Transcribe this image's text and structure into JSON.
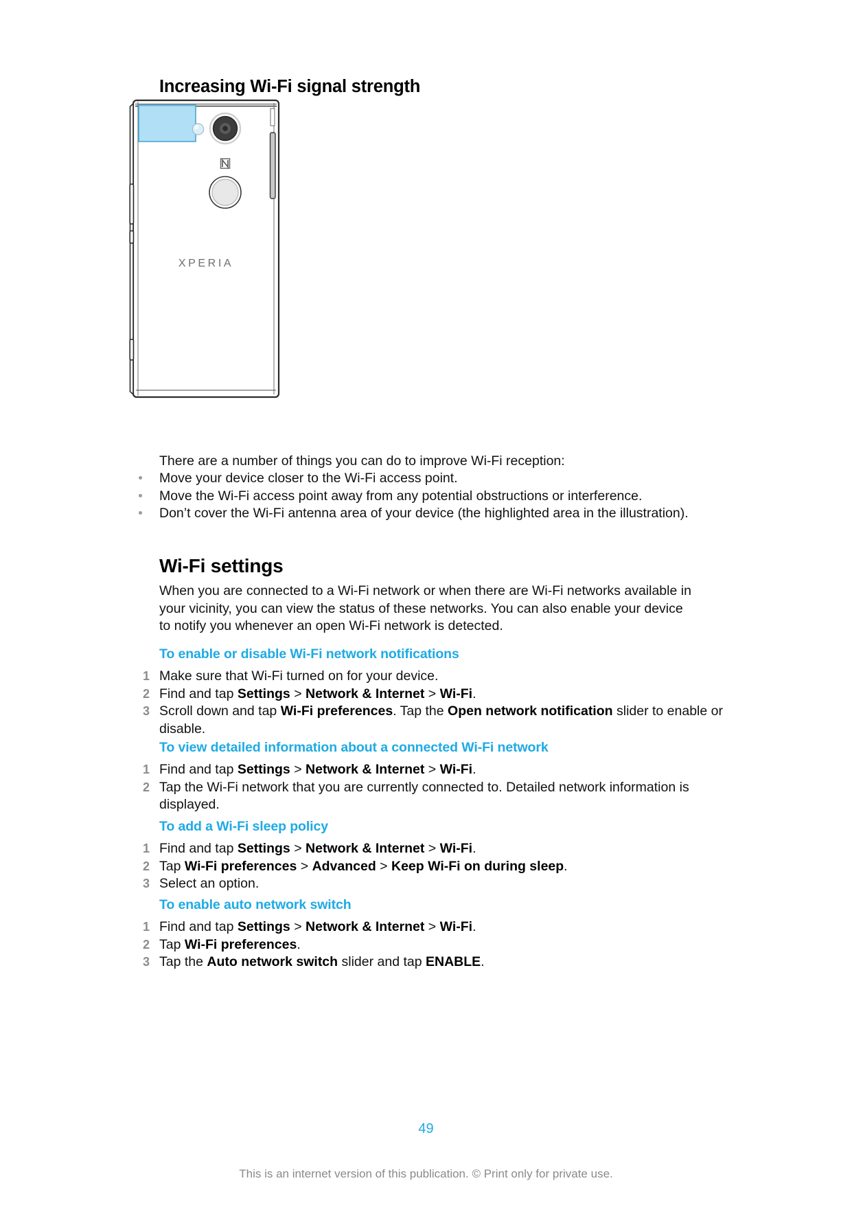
{
  "document": {
    "section_heading": "Increasing Wi-Fi signal strength",
    "illustration": {
      "device_brand": "XPERIA",
      "nfc_label": "N",
      "highlight_color": "#a9dcf5",
      "highlight_border_color": "#4ba7cf",
      "alt": "Back view of Xperia phone with highlighted Wi-Fi antenna area in top left corner"
    },
    "intro": "There are a number of things you can do to improve Wi-Fi reception:",
    "bullets": [
      "Move your device closer to the Wi-Fi access point.",
      "Move the Wi-Fi access point away from any potential obstructions or interference.",
      "Don’t cover the Wi-Fi antenna area of your device (the highlighted area in the illustration)."
    ],
    "major_heading": "Wi-Fi settings",
    "paragraph": "When you are connected to a Wi-Fi network or when there are Wi-Fi networks available in your vicinity, you can view the status of these networks. You can also enable your device to notify you whenever an open Wi-Fi network is detected.",
    "procedures": [
      {
        "heading": "To enable or disable Wi-Fi network notifications",
        "steps": [
          [
            {
              "t": "Make sure that Wi-Fi turned on for your device.",
              "bold": false
            }
          ],
          [
            {
              "t": "Find and tap ",
              "bold": false
            },
            {
              "t": "Settings",
              "bold": true
            },
            {
              "t": " > ",
              "bold": false
            },
            {
              "t": "Network & Internet",
              "bold": true
            },
            {
              "t": " > ",
              "bold": false
            },
            {
              "t": "Wi-Fi",
              "bold": true
            },
            {
              "t": ".",
              "bold": false
            }
          ],
          [
            {
              "t": "Scroll down and tap ",
              "bold": false
            },
            {
              "t": "Wi-Fi preferences",
              "bold": true
            },
            {
              "t": ". Tap the ",
              "bold": false
            },
            {
              "t": "Open network notification",
              "bold": true
            },
            {
              "t": " slider to enable or disable.",
              "bold": false
            }
          ]
        ]
      },
      {
        "heading": "To view detailed information about a connected Wi-Fi network",
        "steps": [
          [
            {
              "t": "Find and tap ",
              "bold": false
            },
            {
              "t": "Settings",
              "bold": true
            },
            {
              "t": " > ",
              "bold": false
            },
            {
              "t": "Network & Internet",
              "bold": true
            },
            {
              "t": " > ",
              "bold": false
            },
            {
              "t": "Wi-Fi",
              "bold": true
            },
            {
              "t": ".",
              "bold": false
            }
          ],
          [
            {
              "t": "Tap the Wi-Fi network that you are currently connected to. Detailed network information is displayed.",
              "bold": false
            }
          ]
        ]
      },
      {
        "heading": "To add a Wi-Fi sleep policy",
        "steps": [
          [
            {
              "t": "Find and tap ",
              "bold": false
            },
            {
              "t": "Settings",
              "bold": true
            },
            {
              "t": " > ",
              "bold": false
            },
            {
              "t": "Network & Internet",
              "bold": true
            },
            {
              "t": " > ",
              "bold": false
            },
            {
              "t": "Wi-Fi",
              "bold": true
            },
            {
              "t": ".",
              "bold": false
            }
          ],
          [
            {
              "t": "Tap ",
              "bold": false
            },
            {
              "t": "Wi-Fi preferences",
              "bold": true
            },
            {
              "t": " > ",
              "bold": false
            },
            {
              "t": "Advanced",
              "bold": true
            },
            {
              "t": " > ",
              "bold": false
            },
            {
              "t": "Keep Wi-Fi on during sleep",
              "bold": true
            },
            {
              "t": ".",
              "bold": false
            }
          ],
          [
            {
              "t": "Select an option.",
              "bold": false
            }
          ]
        ]
      },
      {
        "heading": "To enable auto network switch",
        "steps": [
          [
            {
              "t": "Find and tap ",
              "bold": false
            },
            {
              "t": "Settings",
              "bold": true
            },
            {
              "t": " > ",
              "bold": false
            },
            {
              "t": "Network & Internet",
              "bold": true
            },
            {
              "t": " > ",
              "bold": false
            },
            {
              "t": "Wi-Fi",
              "bold": true
            },
            {
              "t": ".",
              "bold": false
            }
          ],
          [
            {
              "t": "Tap ",
              "bold": false
            },
            {
              "t": "Wi-Fi preferences",
              "bold": true
            },
            {
              "t": ".",
              "bold": false
            }
          ],
          [
            {
              "t": "Tap the ",
              "bold": false
            },
            {
              "t": "Auto network switch",
              "bold": true
            },
            {
              "t": " slider and tap ",
              "bold": false
            },
            {
              "t": "ENABLE",
              "bold": true
            },
            {
              "t": ".",
              "bold": false
            }
          ]
        ]
      }
    ],
    "footer": {
      "page_number": "49",
      "disclaimer": "This is an internet version of this publication. © Print only for private use."
    },
    "colors": {
      "accent_blue": "#1eaae4",
      "step_number_gray": "#8c8c8c",
      "disclaimer_gray": "#8a8a8a"
    }
  }
}
